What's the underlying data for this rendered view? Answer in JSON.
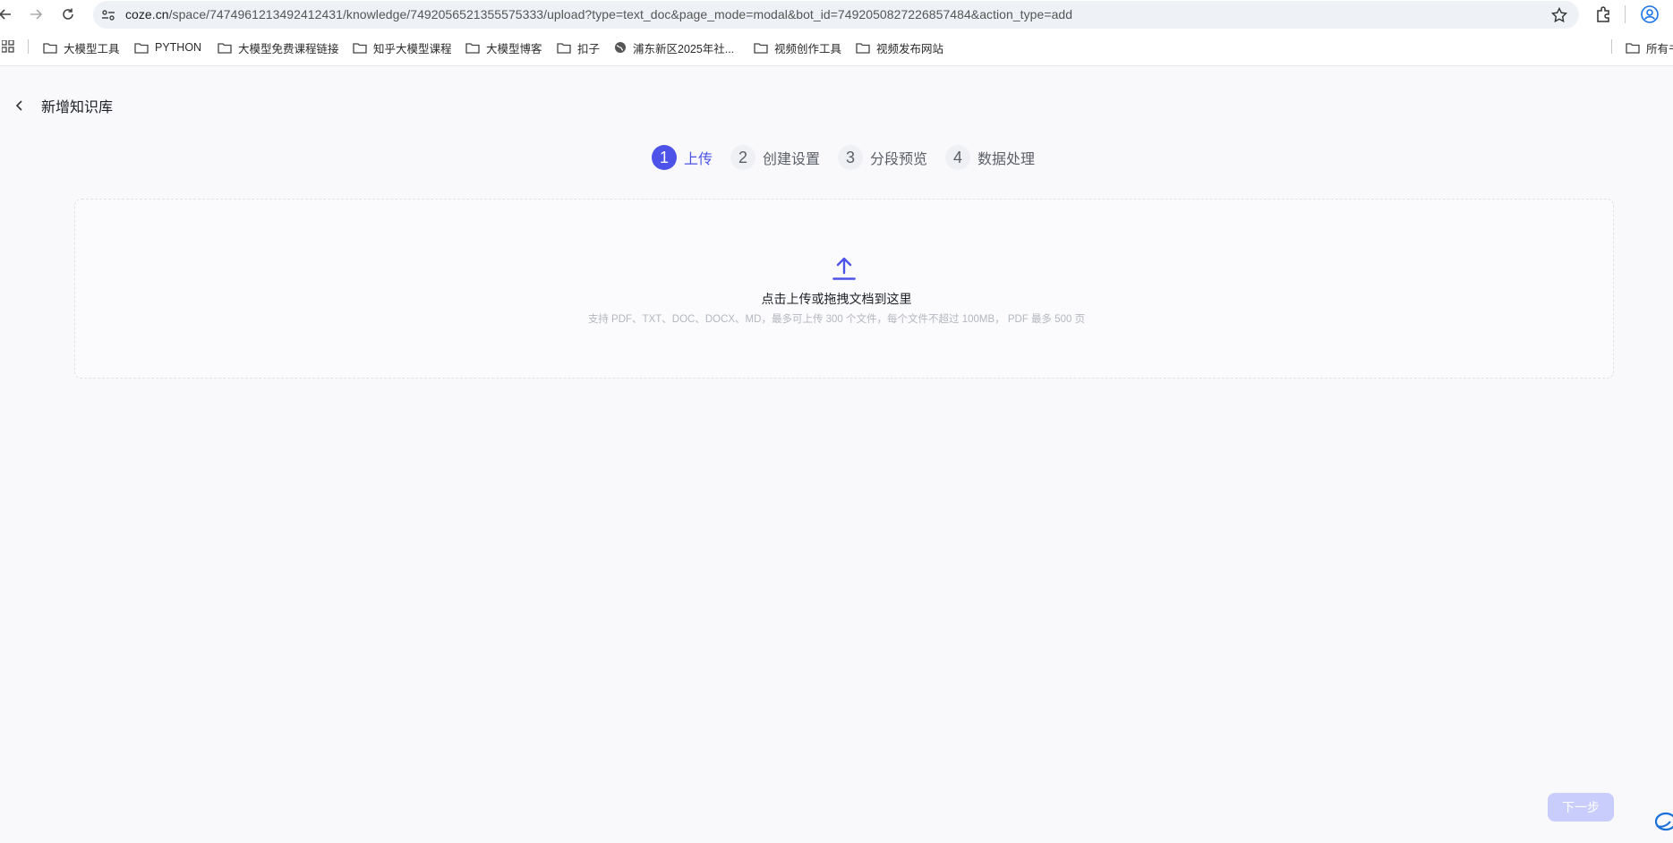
{
  "browser": {
    "url_host": "coze.cn",
    "url_path": "/space/7474961213492412431/knowledge/7492056521355575333/upload?type=text_doc&page_mode=modal&bot_id=7492050827226857484&action_type=add"
  },
  "bookmarks": [
    {
      "label": "大模型工具",
      "icon": "folder-icon"
    },
    {
      "label": "PYTHON",
      "icon": "folder-icon"
    },
    {
      "label": "大模型免费课程链接",
      "icon": "folder-icon"
    },
    {
      "label": "知乎大模型课程",
      "icon": "folder-icon"
    },
    {
      "label": "大模型博客",
      "icon": "folder-icon"
    },
    {
      "label": "扣子",
      "icon": "folder-icon"
    },
    {
      "label": "浦东新区2025年社...",
      "icon": "globe-icon"
    },
    {
      "label": "视频创作工具",
      "icon": "folder-icon"
    },
    {
      "label": "视频发布网站",
      "icon": "folder-icon"
    },
    {
      "label": "所有书",
      "icon": "folder-icon"
    }
  ],
  "page": {
    "title": "新增知识库"
  },
  "steps": [
    {
      "num": "1",
      "label": "上传",
      "active": true
    },
    {
      "num": "2",
      "label": "创建设置",
      "active": false
    },
    {
      "num": "3",
      "label": "分段预览",
      "active": false
    },
    {
      "num": "4",
      "label": "数据处理",
      "active": false
    }
  ],
  "dropzone": {
    "title": "点击上传或拖拽文档到这里",
    "hint": "支持 PDF、TXT、DOC、DOCX、MD，最多可上传 300 个文件，每个文件不超过 100MB， PDF 最多 500 页"
  },
  "footer": {
    "next_label": "下一步"
  },
  "colors": {
    "accent": "#4d53e8",
    "accent_disabled": "#c9cdfb",
    "background": "#f9f9fc"
  }
}
